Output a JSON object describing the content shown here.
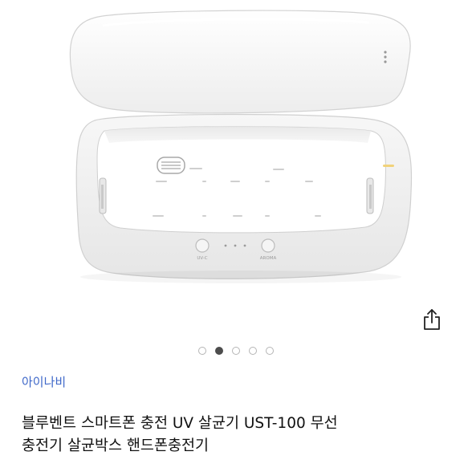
{
  "product": {
    "image_alt": "UV 살균기 제품 사진",
    "device_labels": {
      "left_button": "UV-C",
      "right_button": "AROMA"
    }
  },
  "actions": {
    "share_icon": "share-icon"
  },
  "gallery": {
    "total": 5,
    "active_index": 1
  },
  "seller": {
    "name": "아이나비"
  },
  "title": {
    "line1": "블루벤트 스마트폰 충전 UV 살균기 UST-100 무선",
    "line2": "충전기 살균박스 핸드폰충전기"
  },
  "colors": {
    "seller_link": "#3f68c9",
    "active_dot": "#4d4d4d"
  }
}
